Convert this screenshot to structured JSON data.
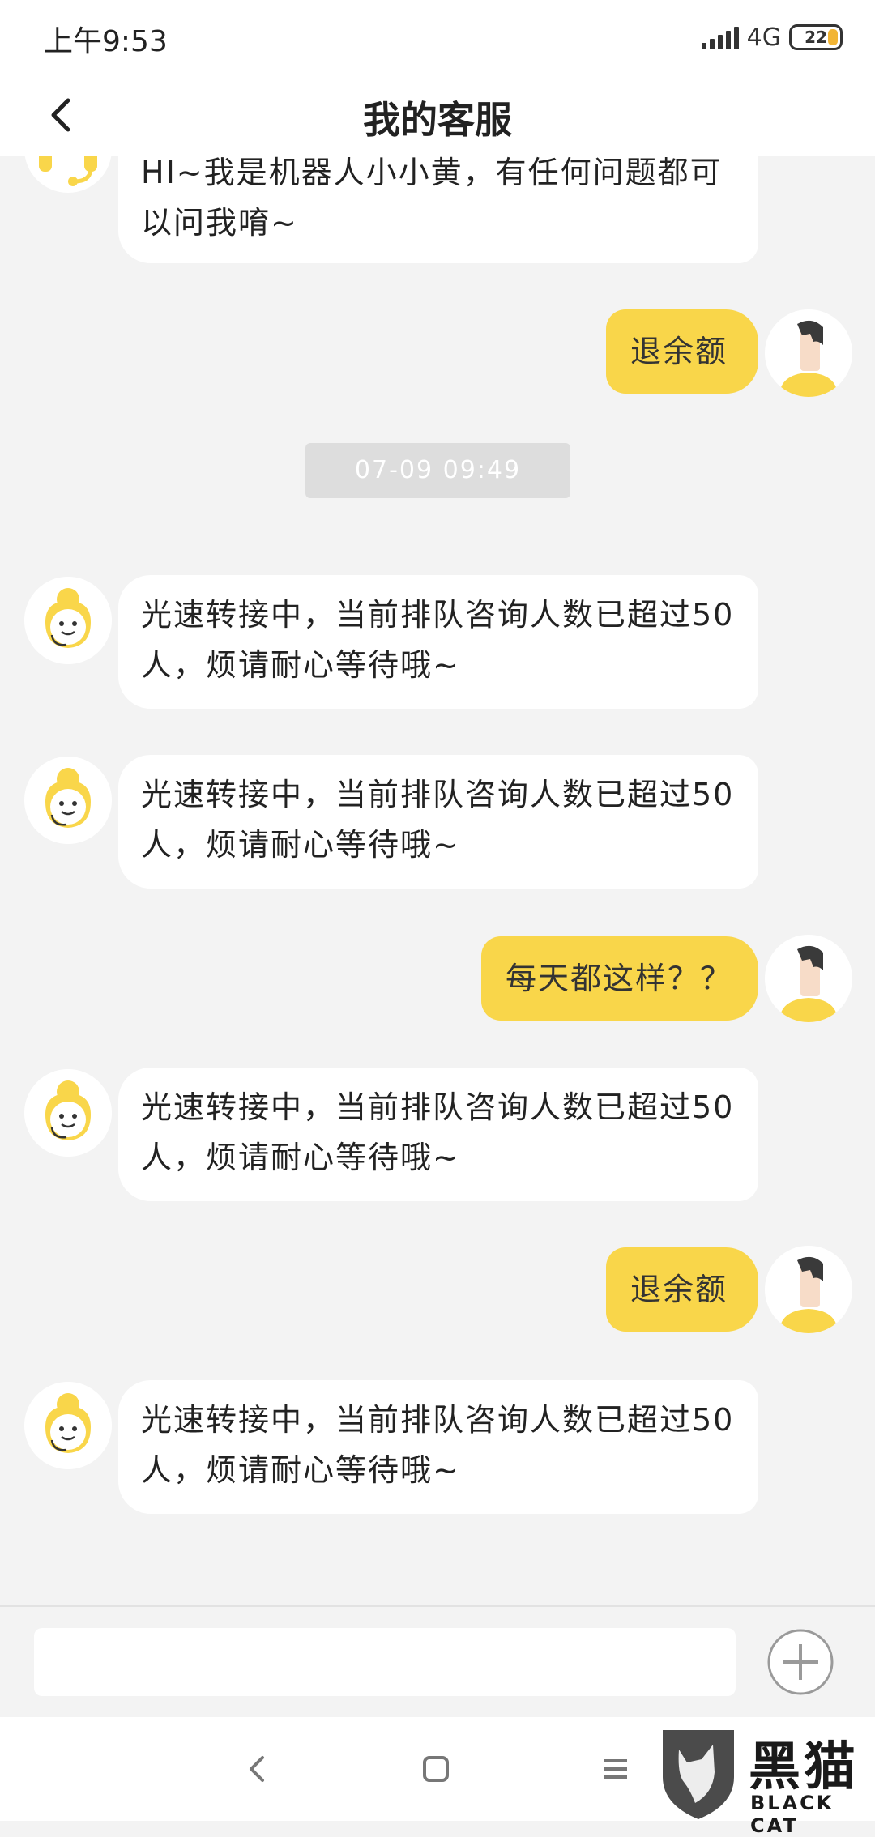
{
  "status_bar": {
    "time": "上午9:53",
    "network": "4G",
    "battery": "22"
  },
  "header": {
    "title": "我的客服"
  },
  "messages": [
    {
      "from": "bot",
      "text": "HI~我是机器人小小黄，有任何问题都可以问我唷~"
    },
    {
      "from": "user",
      "text": "退余额"
    },
    {
      "type": "timestamp",
      "text": "07-09 09:49"
    },
    {
      "from": "agent",
      "text": "光速转接中，当前排队咨询人数已超过50人，烦请耐心等待哦~"
    },
    {
      "from": "agent",
      "text": "光速转接中，当前排队咨询人数已超过50人，烦请耐心等待哦~"
    },
    {
      "from": "user",
      "text": "每天都这样？？"
    },
    {
      "from": "agent",
      "text": "光速转接中，当前排队咨询人数已超过50人，烦请耐心等待哦~"
    },
    {
      "from": "user",
      "text": "退余额"
    },
    {
      "from": "agent",
      "text": "光速转接中，当前排队咨询人数已超过50人，烦请耐心等待哦~"
    }
  ],
  "input": {
    "value": "",
    "placeholder": ""
  },
  "watermark": {
    "text": "黑猫",
    "sub": "BLACK CAT"
  },
  "icons": {
    "back": "chevron-left-icon",
    "plus": "plus-circle-icon",
    "nav_back": "nav-back-icon",
    "nav_home": "nav-home-icon",
    "nav_menu": "nav-menu-icon",
    "bot_avatar": "headset-icon",
    "agent_avatar": "agent-avatar",
    "user_avatar": "user-avatar"
  },
  "colors": {
    "accent": "#f9d64a",
    "background": "#f3f3f3",
    "bubble_left": "#ffffff"
  }
}
